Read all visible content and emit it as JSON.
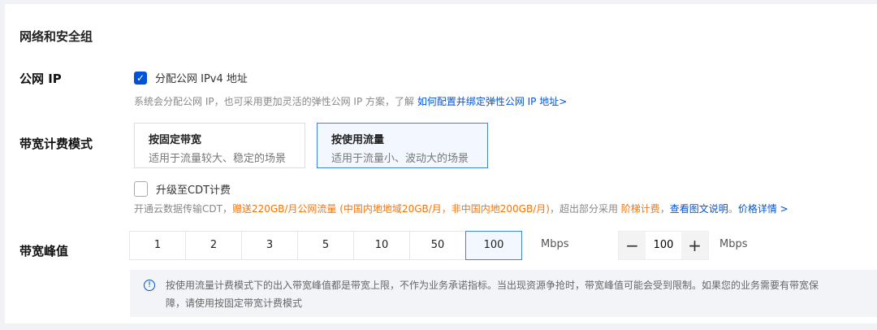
{
  "section_title": "网络和安全组",
  "public_ip": {
    "label": "公网 IP",
    "checkbox_label": "分配公网 IPv4 地址",
    "checked": true,
    "hint": "系统会分配公网 IP，也可采用更加灵活的弹性公网 IP 方案，了解 ",
    "hint_link": "如何配置并绑定弹性公网 IP 地址>"
  },
  "billing": {
    "label": "带宽计费模式",
    "options": [
      {
        "title": "按固定带宽",
        "desc": "适用于流量较大、稳定的场景"
      },
      {
        "title": "按使用流量",
        "desc": "适用于流量小、波动大的场景"
      }
    ],
    "selected": 1,
    "cdt_checkbox": "升级至CDT计费",
    "cdt_checked": false,
    "cdt_hint_1": "开通云数据传输CDT，",
    "cdt_hint_orange": "赠送220GB/月公网流量 (中国内地地域20GB/月，非中国内地200GB/月)",
    "cdt_hint_2": "，超出部分采用 ",
    "cdt_hint_orange2": "阶梯计费",
    "cdt_hint_3": "，",
    "cdt_link1": "查看图文说明",
    "cdt_hint_4": "。",
    "cdt_link2": "价格详情 >"
  },
  "bandwidth": {
    "label": "带宽峰值",
    "options": [
      "1",
      "2",
      "3",
      "5",
      "10",
      "50",
      "100"
    ],
    "selected": "100",
    "unit": "Mbps",
    "stepper_value": "100",
    "stepper_minus": "−",
    "stepper_plus": "+",
    "stepper_unit": "Mbps",
    "info_line1": "按使用流量计费模式下的出入带宽峰值都是带宽上限，不作为业务承诺指标。当出现资源争抢时，带宽峰值可能会受到限制。如果您的业务需要有带宽保",
    "info_line2": "障，请使用按固定带宽计费模式",
    "info_icon": "!"
  }
}
